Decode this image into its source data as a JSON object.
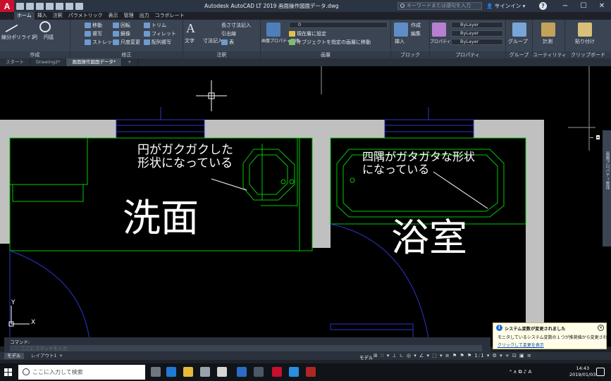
{
  "titlebar": {
    "logo": "A",
    "title": "Autodesk AutoCAD LT 2019   画面操作図面データ.dwg",
    "search_placeholder": "キーワードまたは語句を入力",
    "signin": "サインイン",
    "help": "?"
  },
  "ribbon_tabs": [
    "ホーム",
    "挿入",
    "注釈",
    "パラメトリック",
    "表示",
    "管理",
    "出力",
    "コラボレート"
  ],
  "ribbon": {
    "draw_label": "作成",
    "draw_items": [
      "線分",
      "ポリライン",
      "円",
      "円弧"
    ],
    "modify_label": "修正",
    "modify_items": [
      "移動",
      "回転",
      "トリム",
      "複写",
      "鏡像",
      "フィレット",
      "ストレッチ",
      "尺度変更",
      "配列複写"
    ],
    "annotation_label": "注釈",
    "annotation_items": [
      "文字",
      "寸法記入",
      "長さ寸法記入",
      "引出線",
      "表"
    ],
    "layers_label": "画層",
    "layer_props": "画層プロパティ管理",
    "layer_current": "0",
    "layer_items": [
      "現在層に設定",
      "オブジェクトを指定の画層に移動"
    ],
    "block_label": "ブロック",
    "block_items": [
      "挿入",
      "作成",
      "編集"
    ],
    "props_label": "プロパティ",
    "props_values": [
      "ByLayer",
      "ByLayer",
      "ByLayer"
    ],
    "props_match": "プロパティコピー",
    "groups_label": "グループ",
    "groups_item": "グループ",
    "util_label": "ユーティリティ",
    "util_item": "計測",
    "clip_label": "クリップボード",
    "clip_item": "貼り付け"
  },
  "file_tabs": [
    {
      "label": "スタート",
      "active": false
    },
    {
      "label": "Drawing2*",
      "active": false
    },
    {
      "label": "画面操作図面データ*",
      "active": true
    }
  ],
  "drawing": {
    "annotation_left": [
      "円がガクガクした",
      "形状になっている"
    ],
    "annotation_right": [
      "四隅がガタガタな形状",
      "になっている"
    ],
    "room_left": "洗面",
    "room_right": "浴室",
    "axis_y": "Y",
    "axis_x": "X",
    "palette_label": "画層プロパティ管理"
  },
  "notification": {
    "title": "システム変数が変更されました",
    "body": "モニタしているシステム変数の１つが推奨値から変更されました",
    "link": "クリックして変更を表示"
  },
  "cmdline": {
    "history": "コマンド:",
    "placeholder": "ここにコマンドを入力"
  },
  "layout_tabs": [
    "モデル",
    "レイアウト1"
  ],
  "status": {
    "model": "モデル",
    "icons": "⊞ ∷ ▾ ⊥ ∟ ◎ ▾ ∠ ▾ ⬚ ▾ ≡ ⚑ ⚑ ⚑ 1:1 ▾ ⚙ ▾ + ⊡ ▣ ≡"
  },
  "taskbar": {
    "search": "ここに入力して検索",
    "clock_time": "14:43",
    "clock_date": "2019/01/03",
    "tray": "ᴬ ∧ ⧉ ♪ A"
  },
  "colors": {
    "wall": "#c0c0c0",
    "fixture": "#00c800",
    "door": "#2c35c8",
    "annotation": "#ffffff",
    "title_bg": "#2b3442",
    "ribbon_bg": "#3a4453"
  }
}
